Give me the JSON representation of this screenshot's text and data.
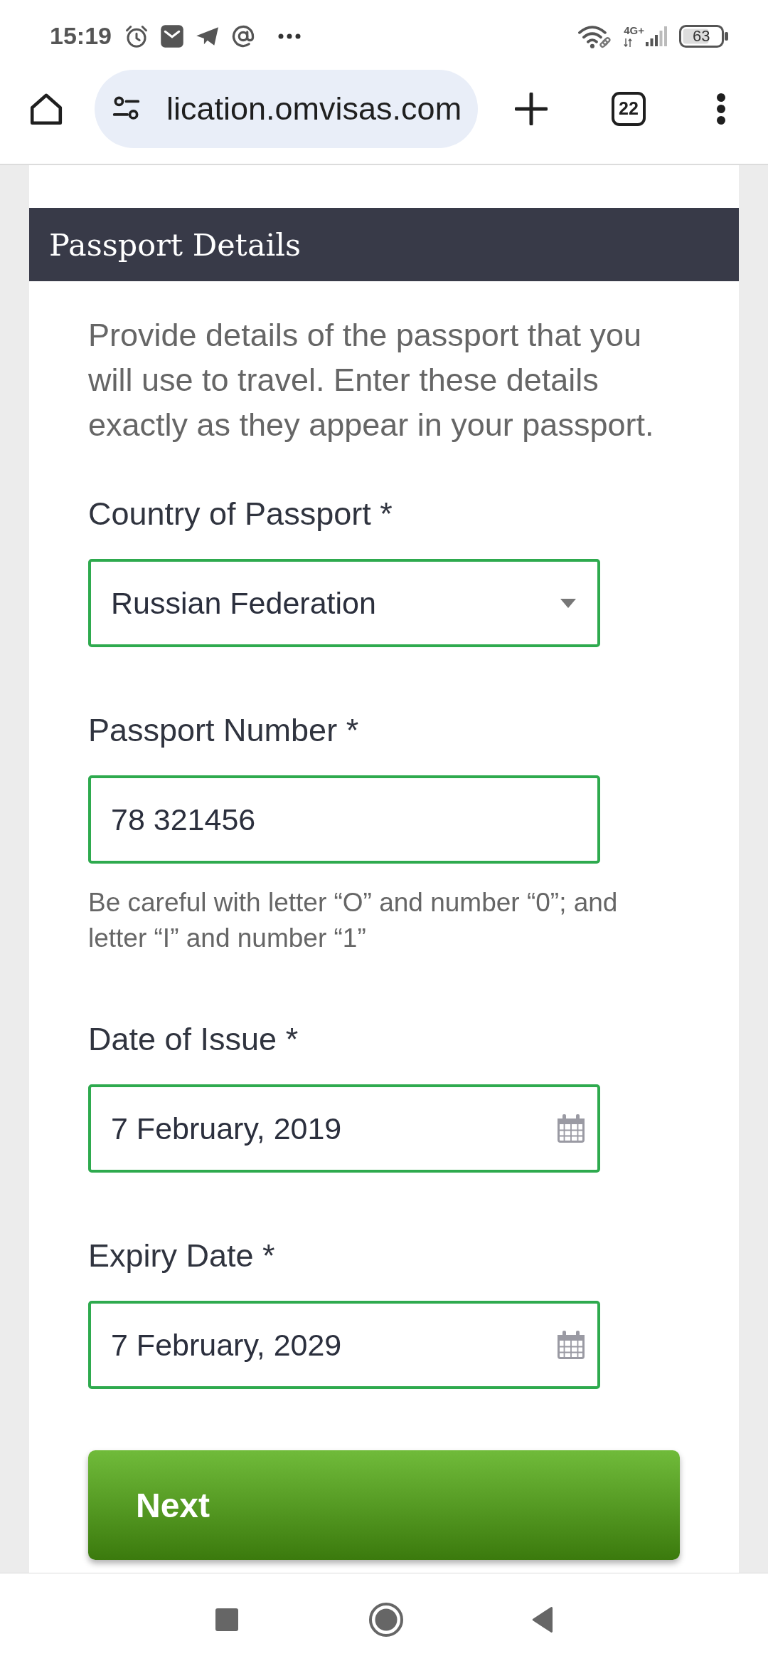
{
  "status_bar": {
    "time": "15:19",
    "network": "4G+",
    "battery": "63"
  },
  "browser": {
    "url": "lication.omvisas.com",
    "tab_count": "22"
  },
  "section": {
    "title": "Passport Details",
    "intro": "Provide details of the passport that you will use to travel. Enter these details exactly as they appear in your passport."
  },
  "form": {
    "fields": [
      {
        "kind": "select",
        "label": "Country of Passport *",
        "value": "Russian Federation",
        "valid": true
      },
      {
        "kind": "text",
        "label": "Passport Number *",
        "value": "78 321456",
        "valid": true,
        "hint": "Be careful with letter “O” and number “0”; and letter “I” and number “1”"
      },
      {
        "kind": "date",
        "label": "Date of Issue *",
        "value": "7 February, 2019",
        "valid": true
      },
      {
        "kind": "date",
        "label": "Expiry Date *",
        "value": "7 February, 2029",
        "valid": true
      }
    ],
    "submit": "Next"
  }
}
